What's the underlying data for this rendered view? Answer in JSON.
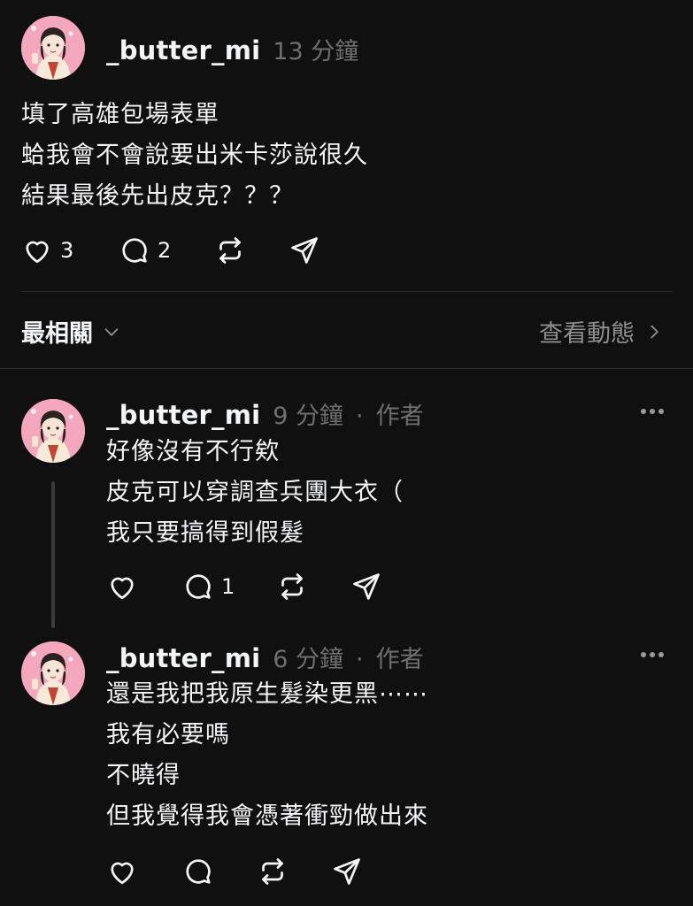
{
  "post": {
    "username": "_butter_mi",
    "time": "13 分鐘",
    "lines": [
      "填了高雄包場表單",
      "蛤我會不會說要出米卡莎說很久",
      "結果最後先出皮克？？？"
    ],
    "like_count": "3",
    "reply_count": "2"
  },
  "filter": {
    "sort_label": "最相關",
    "view_activity": "查看動態"
  },
  "replies": [
    {
      "username": "_butter_mi",
      "time": "9 分鐘",
      "author_tag": "作者",
      "lines": [
        "好像沒有不行欸",
        "皮克可以穿調查兵團大衣（",
        "我只要搞得到假髮"
      ],
      "reply_count": "1"
    },
    {
      "username": "_butter_mi",
      "time": "6 分鐘",
      "author_tag": "作者",
      "lines": [
        "還是我把我原生髮染更黑⋯⋯",
        "我有必要嗎",
        "不曉得",
        "但我覺得我會憑著衝勁做出來"
      ]
    }
  ],
  "colors": {
    "background": "#101010",
    "text": "#f3f5f7",
    "muted": "#6f6f6f",
    "avatar_bg": "#f4a7bd"
  },
  "icons": [
    "heart-icon",
    "comment-icon",
    "repost-icon",
    "share-icon",
    "chevron-down-icon",
    "chevron-right-icon",
    "more-icon"
  ]
}
